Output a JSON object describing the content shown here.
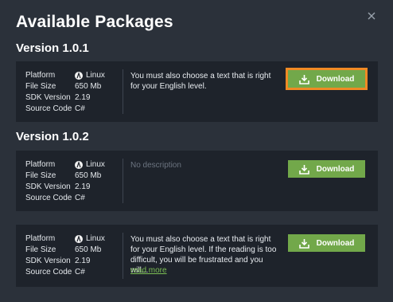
{
  "dialog": {
    "title": "Available Packages",
    "close_icon": "close-icon"
  },
  "meta_labels": {
    "platform": "Platform",
    "file_size": "File Size",
    "sdk_version": "SDK Version",
    "source_code": "Source Code"
  },
  "sections": [
    {
      "title": "Version 1.0.1",
      "packages": [
        {
          "platform": "Linux",
          "file_size": "650 Mb",
          "sdk_version": "2.19",
          "source_code": "C#",
          "description": "You must also choose a text that is right for your English level.",
          "button_label": "Download"
        }
      ]
    },
    {
      "title": "Version 1.0.2",
      "packages": [
        {
          "platform": "Linux",
          "file_size": "650 Mb",
          "sdk_version": "2.19",
          "source_code": "C#",
          "description": "No description",
          "button_label": "Download"
        },
        {
          "platform": "Linux",
          "file_size": "650 Mb",
          "sdk_version": "2.19",
          "source_code": "C#",
          "description": "You must also choose a text that is right for your English level. If the reading is too difficult, you will be frustrated and you will...",
          "read_more": "read more",
          "button_label": "Download"
        }
      ]
    }
  ],
  "colors": {
    "background": "#2b313a",
    "card": "#1e232b",
    "accent_green": "#72a84a",
    "focus_orange": "#f08a24",
    "link_green": "#7cbf54"
  }
}
